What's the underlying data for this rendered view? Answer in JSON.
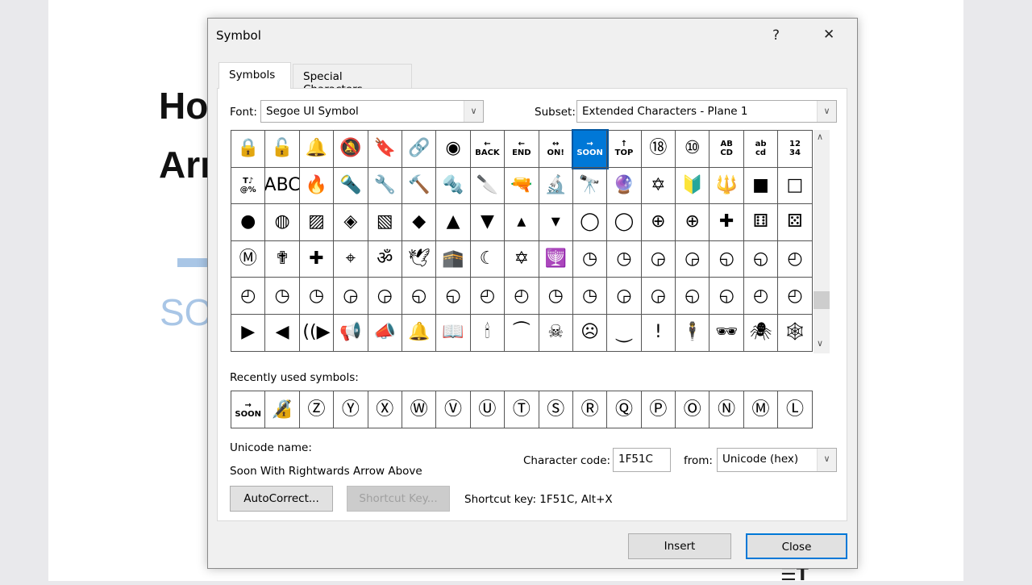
{
  "background": {
    "line1": "Ho",
    "line2": "Arr",
    "blue_text": "SO",
    "corner_icons": "☰T"
  },
  "dialog": {
    "title": "Symbol",
    "help": "?",
    "close": "✕",
    "tabs": [
      "Symbols",
      "Special Characters"
    ],
    "font_label": "Font:",
    "font_value": "Segoe UI Symbol",
    "subset_label": "Subset:",
    "subset_value": "Extended Characters - Plane 1",
    "grid": [
      [
        "🔒",
        "🔓",
        "🔔",
        "🔕",
        "🔖",
        "🔗",
        "◉",
        "←\nBACK",
        "←\nEND",
        "↔\nON!",
        "→\nSOON",
        "↑\nTOP",
        "⑱",
        "⑩",
        "AB\nCD",
        "ab\ncd",
        "12\n34"
      ],
      [
        "T♪\n@%",
        "ABC",
        "🔥",
        "🔦",
        "🔧",
        "🔨",
        "🔩",
        "🔪",
        "🔫",
        "🔬",
        "🔭",
        "🔮",
        "✡",
        "🔰",
        "🔱",
        "■",
        "□"
      ],
      [
        "●",
        "◍",
        "▨",
        "◈",
        "▧",
        "◆",
        "▲",
        "▼",
        "▴",
        "▾",
        "◯",
        "◯",
        "⊕",
        "⊕",
        "✚",
        "⚅",
        "⚄"
      ],
      [
        "Ⓜ",
        "✟",
        "✚",
        "⌖",
        "ॐ",
        "🕊",
        "🕋",
        "☾",
        "✡",
        "🕎",
        "◷",
        "◷",
        "◶",
        "◶",
        "◵",
        "◵",
        "◴"
      ],
      [
        "◴",
        "◷",
        "◷",
        "◶",
        "◶",
        "◵",
        "◵",
        "◴",
        "◴",
        "◷",
        "◷",
        "◶",
        "◶",
        "◵",
        "◵",
        "◴",
        "◴"
      ],
      [
        "▶",
        "◀",
        "((▶",
        "📢",
        "📣",
        "🔔",
        "📖",
        "🕯",
        "⏜",
        "☠",
        "☹",
        "⏝",
        "!",
        "🕴",
        "🕶",
        "🕷",
        "🕸"
      ]
    ],
    "selected": {
      "row": 0,
      "col": 10
    },
    "recent_label": "Recently used symbols:",
    "recent": [
      "→\nSOON",
      "🔏",
      "Ⓩ",
      "Ⓨ",
      "Ⓧ",
      "Ⓦ",
      "Ⓥ",
      "Ⓤ",
      "Ⓣ",
      "Ⓢ",
      "Ⓡ",
      "Ⓠ",
      "Ⓟ",
      "Ⓞ",
      "Ⓝ",
      "Ⓜ",
      "Ⓛ"
    ],
    "unicode_name_label": "Unicode name:",
    "unicode_name": "Soon With Rightwards Arrow Above",
    "char_code_label": "Character code:",
    "char_code": "1F51C",
    "from_label": "from:",
    "from_value": "Unicode (hex)",
    "autocorrect": "AutoCorrect...",
    "shortcut_key_btn": "Shortcut Key...",
    "shortcut_text": "Shortcut key: 1F51C, Alt+X",
    "insert": "Insert",
    "close_btn": "Close"
  }
}
